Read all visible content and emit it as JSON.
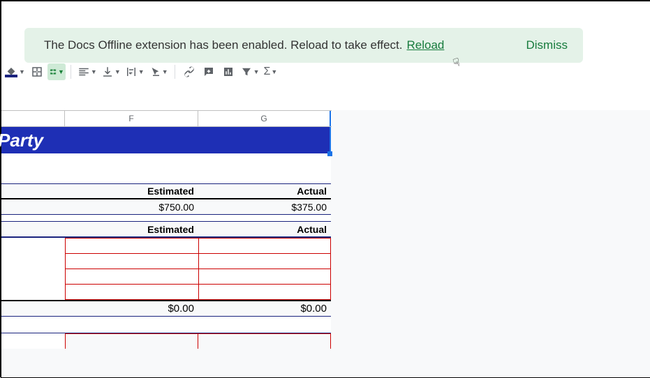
{
  "banner": {
    "message": "The Docs Offline extension has been enabled. Reload to take effect.",
    "reload": "Reload",
    "dismiss": "Dismiss"
  },
  "columns": {
    "F": "F",
    "G": "G"
  },
  "sheet": {
    "title": "Party",
    "section1": {
      "head_est": "Estimated",
      "head_act": "Actual",
      "val_est": "$750.00",
      "val_act": "$375.00"
    },
    "section2": {
      "head_est": "Estimated",
      "head_act": "Actual",
      "tot_est": "$0.00",
      "tot_act": "$0.00"
    }
  }
}
